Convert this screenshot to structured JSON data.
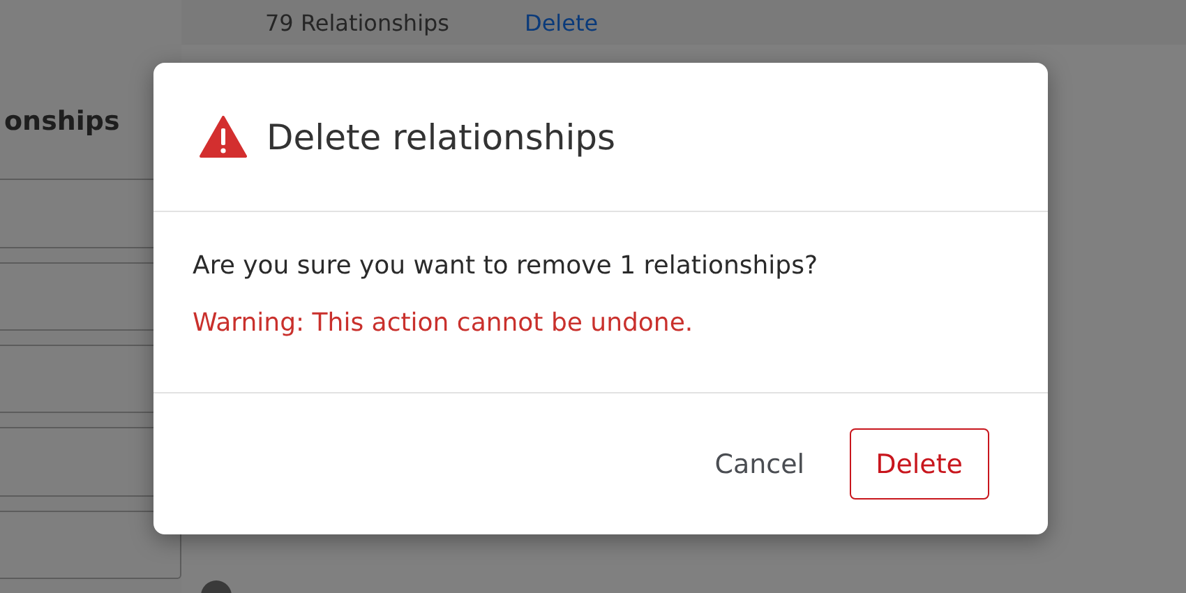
{
  "page": {
    "header": {
      "count": "79 Relationships",
      "action": "Delete"
    },
    "sidebar": {
      "heading": "onships"
    }
  },
  "dialog": {
    "title": "Delete relationships",
    "message": "Are you sure you want to remove 1 relationships?",
    "warning": "Warning: This action cannot be undone.",
    "buttons": [
      {
        "label": "Cancel",
        "kind": "secondary"
      },
      {
        "label": "Delete",
        "kind": "danger"
      }
    ]
  }
}
